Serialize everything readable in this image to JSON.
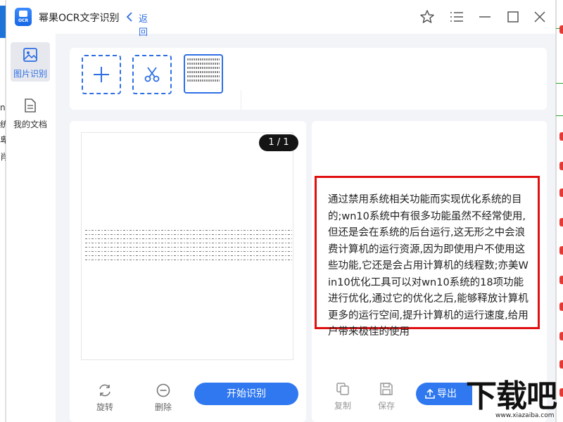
{
  "background_app": {
    "left_fragments": [
      "n",
      "统",
      "卑",
      "肖"
    ]
  },
  "window": {
    "title": "幂果OCR文字识别",
    "logo_text": "OCR",
    "back_label": "返回",
    "controls": [
      "star-icon",
      "menu-icon",
      "minimize-icon",
      "maximize-icon",
      "close-icon"
    ]
  },
  "sidebar": {
    "items": [
      {
        "label": "图片识别",
        "icon": "image-icon",
        "active": true
      },
      {
        "label": "我的文档",
        "icon": "document-icon",
        "active": false
      }
    ]
  },
  "toolbar": {
    "add_icon": "plus-icon",
    "crop_icon": "scissors-icon"
  },
  "preview": {
    "page_indicator": "1 / 1"
  },
  "left_actions": {
    "rotate_label": "旋转",
    "delete_label": "删除",
    "start_label": "开始识别"
  },
  "result": {
    "text": "通过禁用系统相关功能而实现优化系统的目的;wn10系统中有很多功能虽然不经常使用,但还是会在系统的后台运行,这无形之中会浪费计算机的运行资源,因为即使用户不使用这些功能,它还是会占用计算机的线程数;亦美Win10优化工具可以对wn10系统的18项功能进行优化,通过它的优化之后,能够释放计算机更多的运行空间,提升计算机的运行速度,给用户带来极佳的使用"
  },
  "right_actions": {
    "copy_label": "复制",
    "save_label": "保存",
    "export_label": "导出"
  },
  "watermark": {
    "big": "下载吧",
    "small": "www.xiazaiba.com"
  },
  "colors": {
    "accent": "#2f78f0",
    "highlight_border": "#e01010",
    "panel_bg": "#f3f4f8"
  }
}
